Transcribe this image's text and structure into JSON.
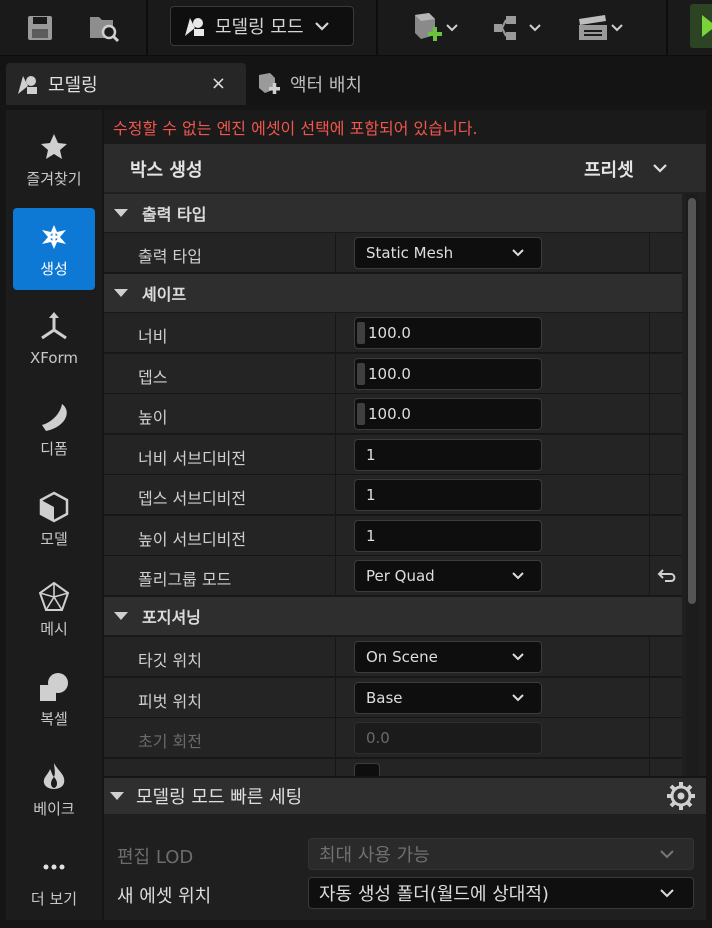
{
  "toolbar": {
    "mode_label": "모델링 모드",
    "icons": [
      "save-icon",
      "browse-content-icon",
      "modeling-mode-icon",
      "add-actor-icon",
      "blueprint-icon",
      "cinematics-icon",
      "play-icon"
    ]
  },
  "tabs": [
    {
      "label": "모델링",
      "active": true,
      "close": "×"
    },
    {
      "label": "액터 배치",
      "active": false
    }
  ],
  "palette": [
    {
      "label": "즐겨찾기",
      "icon": "star-icon",
      "active": false
    },
    {
      "label": "생성",
      "icon": "create-icon",
      "active": true
    },
    {
      "label": "XForm",
      "icon": "xform-icon",
      "active": false
    },
    {
      "label": "디폼",
      "icon": "deform-icon",
      "active": false
    },
    {
      "label": "모델",
      "icon": "model-icon",
      "active": false
    },
    {
      "label": "메시",
      "icon": "mesh-icon",
      "active": false
    },
    {
      "label": "복셀",
      "icon": "voxel-icon",
      "active": false
    },
    {
      "label": "베이크",
      "icon": "bake-icon",
      "active": false
    },
    {
      "label": "더 보기",
      "icon": "more-icon",
      "active": false
    }
  ],
  "panel": {
    "warning": "수정할 수 없는 엔진 에셋이 선택에 포함되어 있습니다.",
    "title": "박스 생성",
    "preset": "프리셋",
    "sections": {
      "output": {
        "label": "출력 타입",
        "rows": [
          {
            "name": "출력 타입",
            "value": "Static Mesh"
          }
        ]
      },
      "shape": {
        "label": "셰이프",
        "rows": [
          {
            "name": "너비",
            "value": "100.0"
          },
          {
            "name": "뎁스",
            "value": "100.0"
          },
          {
            "name": "높이",
            "value": "100.0"
          },
          {
            "name": "너비 서브디비전",
            "value": "1"
          },
          {
            "name": "뎁스 서브디비전",
            "value": "1"
          },
          {
            "name": "높이 서브디비전",
            "value": "1"
          },
          {
            "name": "폴리그룹 모드",
            "value": "Per Quad"
          }
        ]
      },
      "positioning": {
        "label": "포지셔닝",
        "rows": [
          {
            "name": "타깃 위치",
            "value": "On Scene"
          },
          {
            "name": "피벗 위치",
            "value": "Base"
          },
          {
            "name": "초기 회전",
            "value": "0.0"
          }
        ]
      }
    }
  },
  "quick": {
    "title": "모델링 모드 빠른 세팅",
    "edit_lod_label": "편집 LOD",
    "edit_lod_value": "최대 사용 가능",
    "new_asset_label": "새 에셋 위치",
    "new_asset_value": "자동 생성 폴더(월드에 상대적)"
  }
}
